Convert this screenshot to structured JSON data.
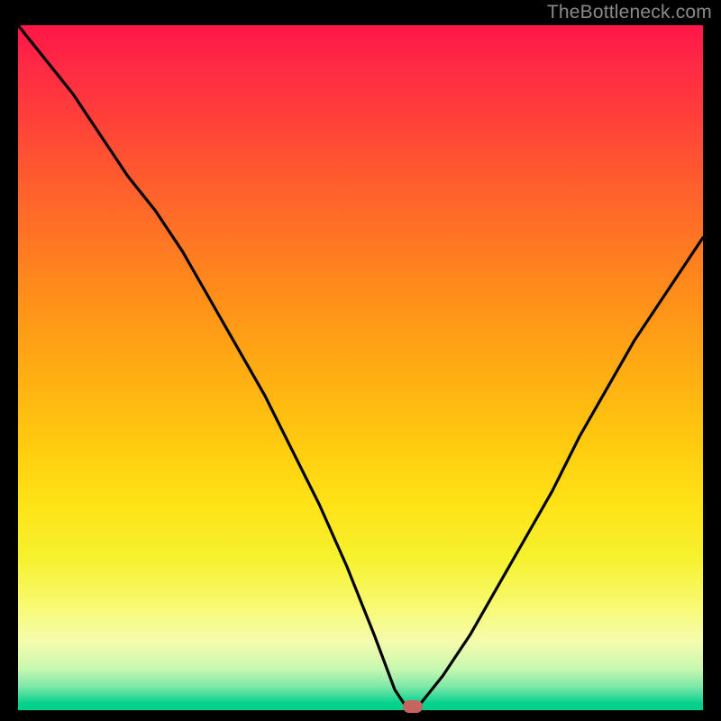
{
  "watermark": "TheBottleneck.com",
  "colors": {
    "frame": "#000000",
    "curve": "#000000",
    "marker": "#c76460",
    "watermark": "#8a8a8a"
  },
  "chart_data": {
    "type": "line",
    "title": "",
    "xlabel": "",
    "ylabel": "",
    "xlim": [
      0,
      100
    ],
    "ylim": [
      0,
      100
    ],
    "description": "V-shaped bottleneck curve over a vertical rainbow gradient (red at top through orange/yellow to green at bottom). The curve drops from the top-left, reaches its minimum at x≈57 where y≈0, then rises toward the right edge. A small rounded marker sits at the minimum.",
    "series": [
      {
        "name": "bottleneck-curve",
        "x": [
          0,
          4,
          8,
          12,
          16,
          20,
          24,
          28,
          32,
          36,
          40,
          44,
          48,
          52,
          55,
          57,
          58,
          62,
          66,
          70,
          74,
          78,
          82,
          86,
          90,
          94,
          98,
          100
        ],
        "values": [
          100,
          95,
          90,
          84,
          78,
          73,
          67,
          60,
          53,
          46,
          38,
          30,
          21,
          11,
          3,
          0,
          0,
          5,
          11,
          18,
          25,
          32,
          40,
          47,
          54,
          60,
          66,
          69
        ]
      }
    ],
    "marker": {
      "x": 57.6,
      "y": 0
    },
    "gradient_stops": [
      {
        "pos": 0,
        "color": "#ff1648"
      },
      {
        "pos": 0.3,
        "color": "#ff7225"
      },
      {
        "pos": 0.62,
        "color": "#ffcd0f"
      },
      {
        "pos": 0.85,
        "color": "#f8fa74"
      },
      {
        "pos": 0.97,
        "color": "#44de9e"
      },
      {
        "pos": 1.0,
        "color": "#00d089"
      }
    ]
  }
}
